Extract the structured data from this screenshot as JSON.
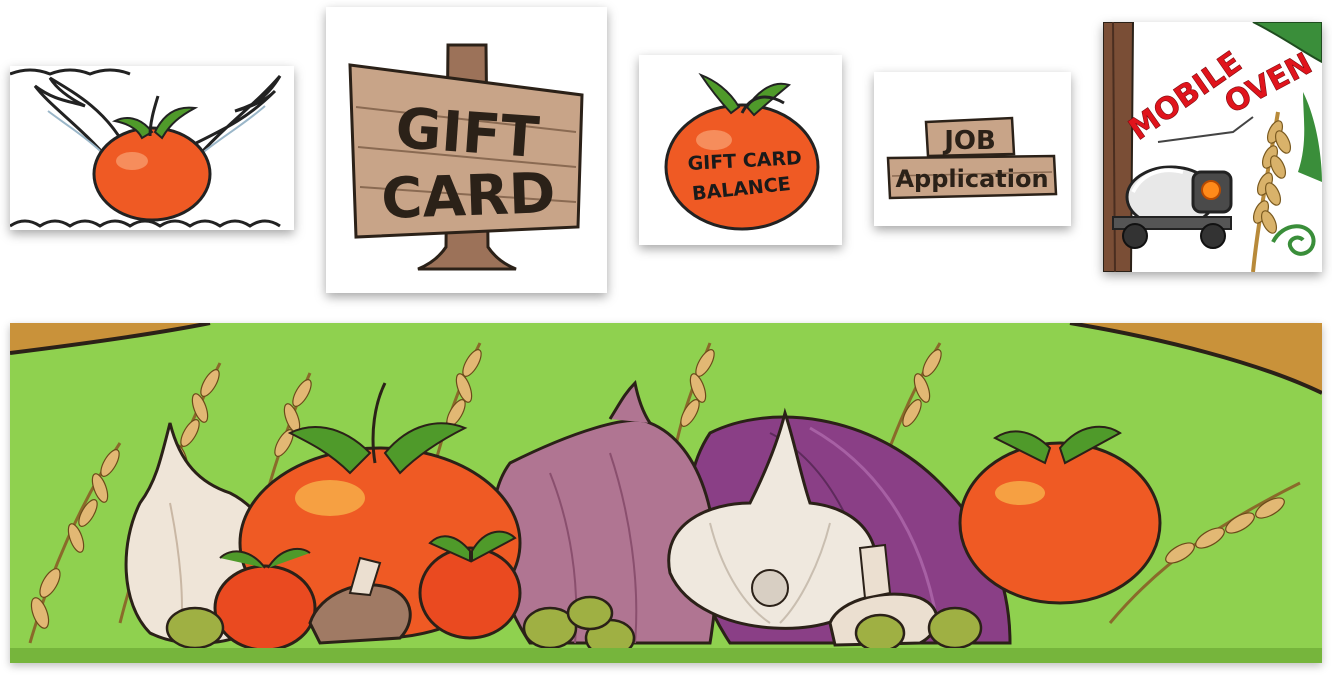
{
  "tiles": {
    "gift_card": {
      "line1": "GIFT",
      "line2": "CARD"
    },
    "gift_card_balance": {
      "line1": "GIFT CARD",
      "line2": "BALANCE"
    },
    "job_application": {
      "line1": "JOB",
      "line2": "Application"
    },
    "mobile_oven": {
      "line1": "MOBILE",
      "line2": "OVEN"
    }
  },
  "colors": {
    "tomato": "#ef5a24",
    "tomato_dark": "#c8361a",
    "leaf": "#4f9a2a",
    "wood": "#b48a6a",
    "wood_dark": "#6b4b34",
    "banner_green": "#8fd14f",
    "onion_purple": "#8a3f86",
    "onion_pink": "#b07592",
    "garlic": "#efe8de",
    "wheat": "#d9b26a",
    "olive": "#9fb043"
  }
}
